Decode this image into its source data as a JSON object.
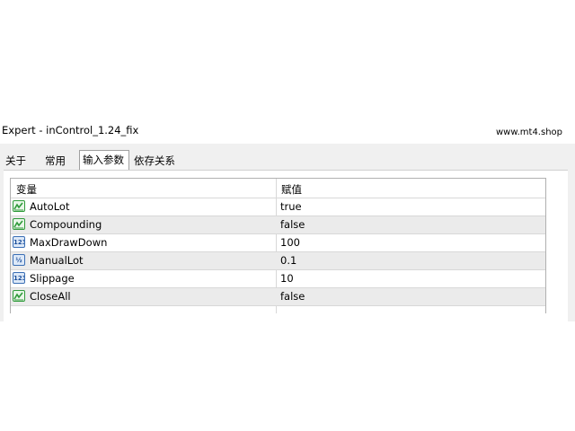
{
  "window": {
    "title": "Expert - inControl_1.24_fix",
    "watermark": "www.mt4.shop"
  },
  "tabs": [
    {
      "label": "关于",
      "active": false
    },
    {
      "label": "常用",
      "active": false
    },
    {
      "label": "输入参数",
      "active": true
    },
    {
      "label": "依存关系",
      "active": false
    }
  ],
  "grid": {
    "columns": {
      "variable": "变量",
      "value": "赋值"
    },
    "rows": [
      {
        "icon": "bool-icon",
        "name": "AutoLot",
        "value": "true"
      },
      {
        "icon": "bool-icon",
        "name": "Compounding",
        "value": "false"
      },
      {
        "icon": "int-icon",
        "name": "MaxDrawDown",
        "value": "100"
      },
      {
        "icon": "double-icon",
        "name": "ManualLot",
        "value": "0.1"
      },
      {
        "icon": "int-icon",
        "name": "Slippage",
        "value": "10"
      },
      {
        "icon": "bool-icon",
        "name": "CloseAll",
        "value": "false"
      }
    ]
  },
  "colors": {
    "bool_icon": "#2f9a3a",
    "int_icon": "#3b6fb5",
    "alt_row": "#ebebeb",
    "dialog_bg": "#f0f0f0"
  }
}
